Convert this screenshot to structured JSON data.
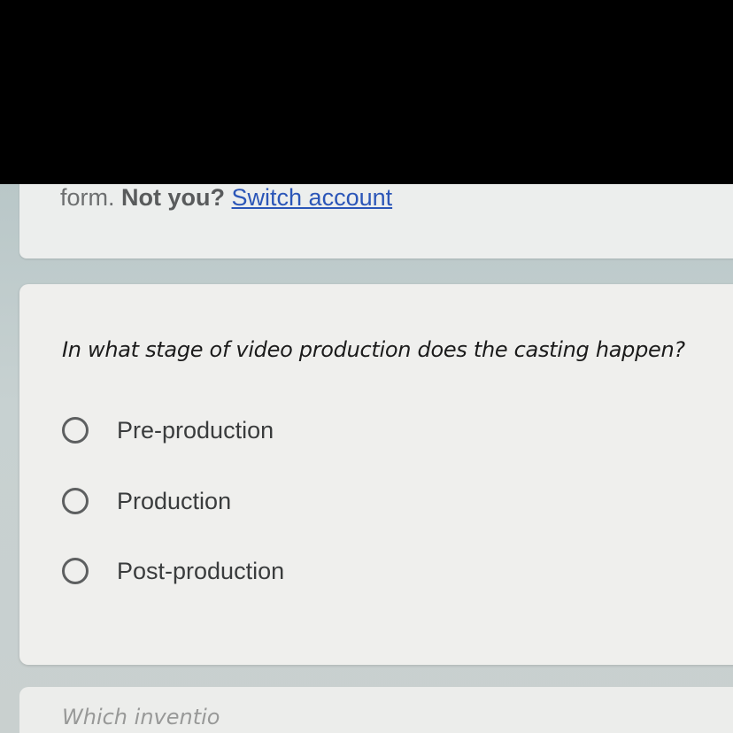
{
  "account_notice": {
    "prefix": "form.",
    "not_you": "Not you?",
    "switch_link": "Switch account"
  },
  "question": {
    "text": "In what stage of video production does the casting happen?",
    "options": [
      {
        "label": "Pre-production",
        "selected": false
      },
      {
        "label": "Production",
        "selected": false
      },
      {
        "label": "Post-production",
        "selected": false
      }
    ]
  },
  "next_question": {
    "text_partial": "Which inventio"
  }
}
